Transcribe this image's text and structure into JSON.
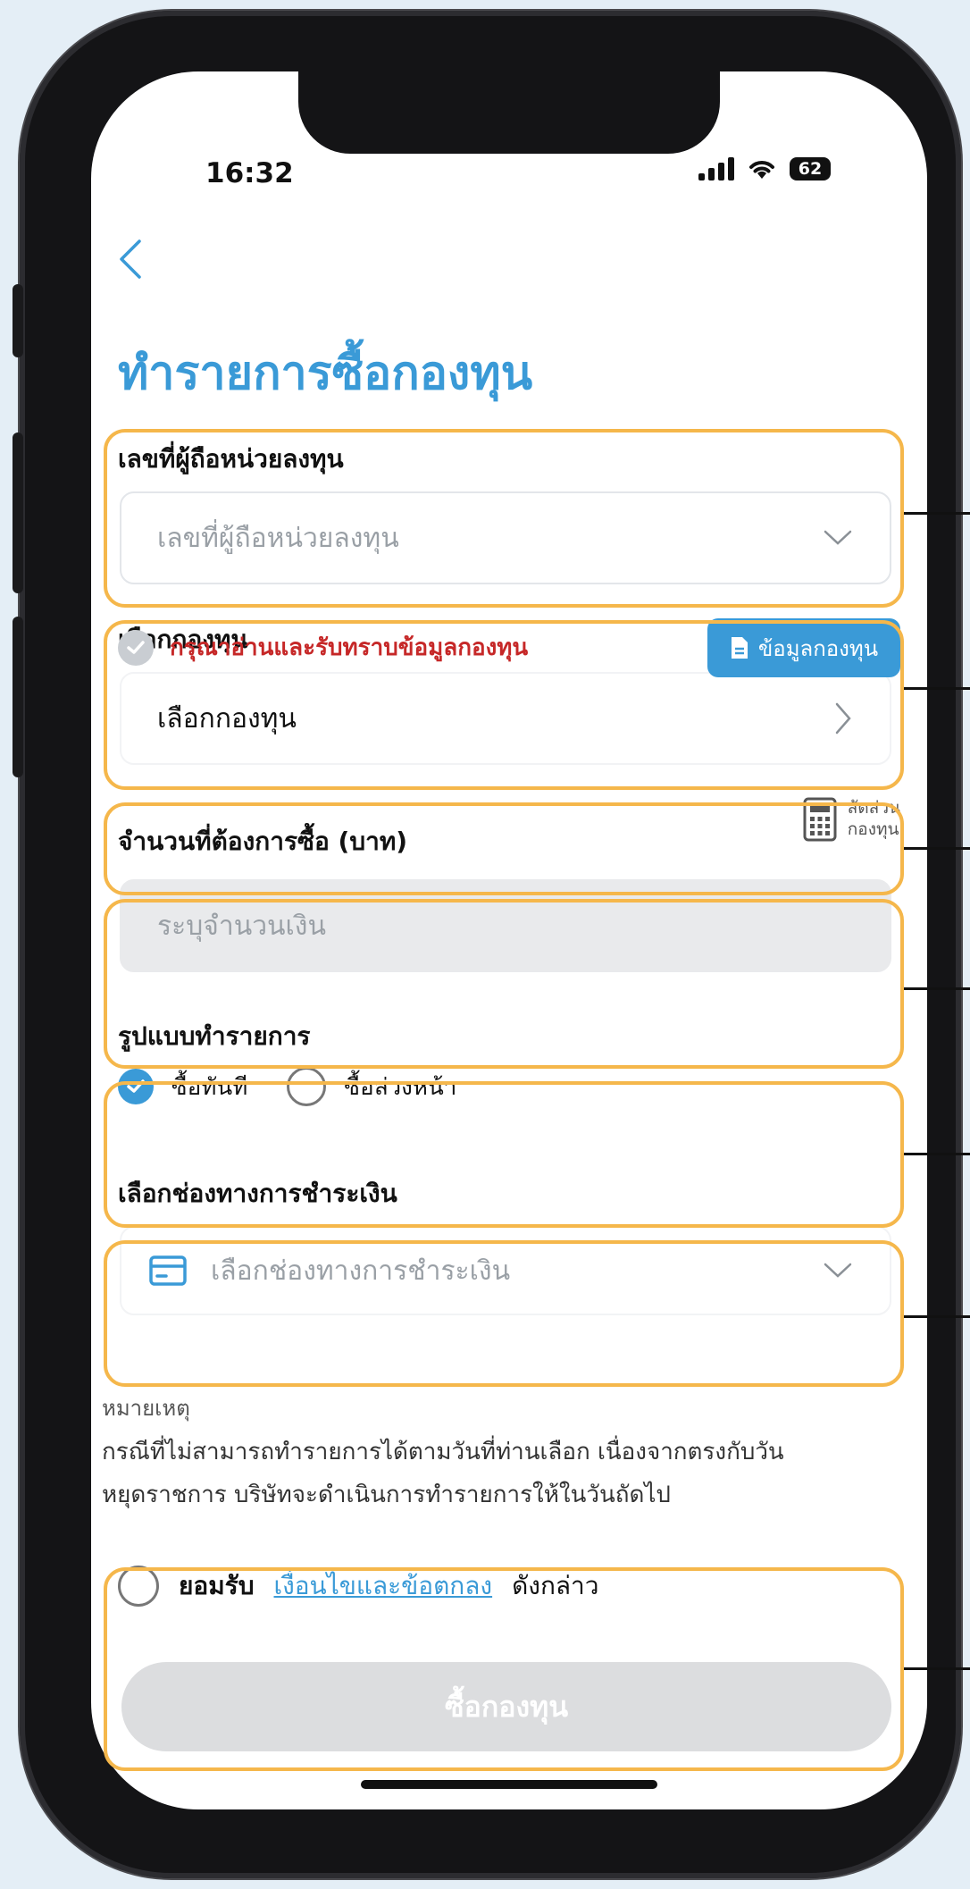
{
  "status_bar": {
    "time": "16:32",
    "battery": "62"
  },
  "page": {
    "title": "ทำรายการซื้อกองทุน"
  },
  "unitholder": {
    "label": "เลขที่ผู้ถือหน่วยลงทุน",
    "placeholder": "เลขที่ผู้ถือหน่วยลงทุน"
  },
  "fund": {
    "label": "เลือกกองทุน",
    "value": "เลือกกองทุน"
  },
  "acknowledge": {
    "text": "กรุณาอ่านและรับทราบข้อมูลกองทุน",
    "button": "ข้อมูลกองทุน"
  },
  "amount": {
    "label": "จำนวนที่ต้องการซื้อ (บาท)",
    "placeholder": "ระบุจำนวนเงิน",
    "ratio_line1": "สัดส่วน",
    "ratio_line2": "กองทุน"
  },
  "transaction_type": {
    "label": "รูปแบบทำรายการ",
    "options": [
      {
        "label": "ซื้อทันที",
        "selected": true
      },
      {
        "label": "ซื้อล่วงหน้า",
        "selected": false
      }
    ]
  },
  "payment": {
    "label": "เลือกช่องทางการชำระเงิน",
    "placeholder": "เลือกช่องทางการชำระเงิน"
  },
  "note": {
    "title": "หมายเหตุ",
    "line1": "กรณีที่ไม่สามารถทำรายการได้ตามวันที่ท่านเลือก เนื่องจากตรงกับวัน",
    "line2": "หยุดราชการ บริษัทจะดำเนินการทำรายการให้ในวันถัดไป"
  },
  "consent": {
    "prefix": "ยอมรับ",
    "link": "เงื่อนไขและข้อตกลง",
    "suffix": "ดังกล่าว"
  },
  "submit": {
    "label": "ซื้อกองทุน"
  },
  "colors": {
    "accent": "#3a9ad7",
    "callout": "#f5b74b",
    "warning_text": "#c62828",
    "disabled": "#dcdddf"
  }
}
